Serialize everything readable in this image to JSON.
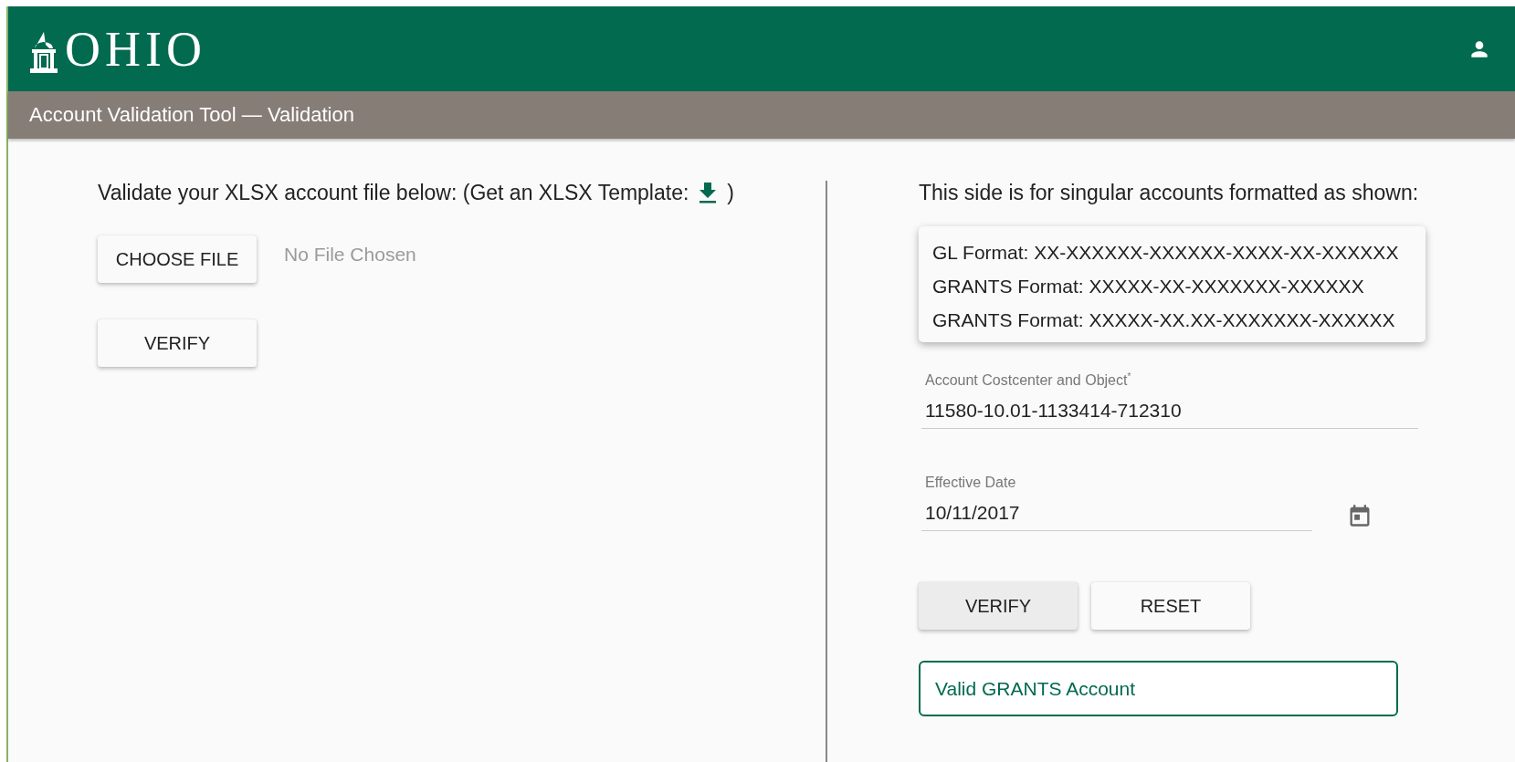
{
  "header": {
    "logo_text": "OHIO"
  },
  "title_bar": {
    "title": "Account Validation Tool — Validation"
  },
  "file_panel": {
    "instruction": "Validate your XLSX account file below: (Get an XLSX Template:",
    "instruction_end": ")",
    "choose_button": "CHOOSE FILE",
    "file_status": "No File Chosen",
    "verify_button": "VERIFY"
  },
  "account_panel": {
    "intro": "This side is for singular accounts formatted as shown:",
    "formats": [
      "GL Format: XX-XXXXXX-XXXXXX-XXXX-XX-XXXXXX",
      "GRANTS Format: XXXXX-XX-XXXXXXX-XXXXXX",
      "GRANTS Format: XXXXX-XX.XX-XXXXXXX-XXXXXX"
    ],
    "fields": [
      {
        "label": "Account Costcenter and Object",
        "required_mark": "*",
        "value": "11580-10.01-1133414-712310",
        "kind": "text"
      },
      {
        "label": "Effective Date",
        "value": "10/11/2017",
        "kind": "date"
      }
    ],
    "buttons": [
      {
        "label": "VERIFY",
        "focused": true
      },
      {
        "label": "RESET",
        "focused": false
      }
    ],
    "result": {
      "text": "Valid GRANTS Account",
      "color": "#006a4e"
    }
  }
}
